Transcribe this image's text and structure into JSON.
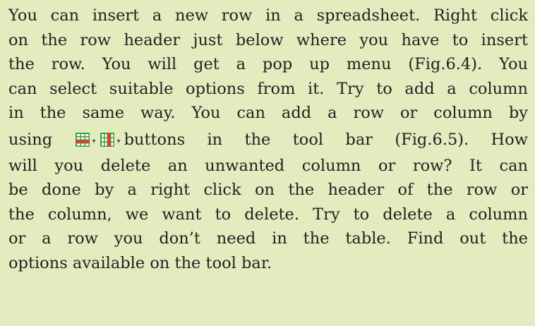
{
  "paragraph": {
    "lines": [
      "You can insert a new row in a spreadsheet. Right click",
      "on the row header just below where you have to insert",
      "the row. You will get a pop up menu (Fig.6.4). You",
      "can select suitable options from it. Try to add a column",
      "in the same way. You can add a row or column by",
      "will you delete an unwanted column or row? It can",
      "be done by a right click on the header of the row or",
      "the column, we want to delete. Try to delete a column",
      "or a row you don’t need in the table. Find out the",
      "options available on the tool bar."
    ],
    "toolbar_line": {
      "before": "using",
      "after": "buttons in the tool bar (Fig.6.5). How"
    },
    "arrow_glyph": "▾"
  },
  "icons": {
    "insert_row": "insert-row-icon",
    "insert_column": "insert-column-icon",
    "dropdown": "chevron-down-icon"
  },
  "colors": {
    "background": "#e3ecbf",
    "text": "#231f20",
    "icon_green": "#3f9b3c",
    "icon_red": "#e53b2f",
    "icon_cell": "#ffffff"
  }
}
